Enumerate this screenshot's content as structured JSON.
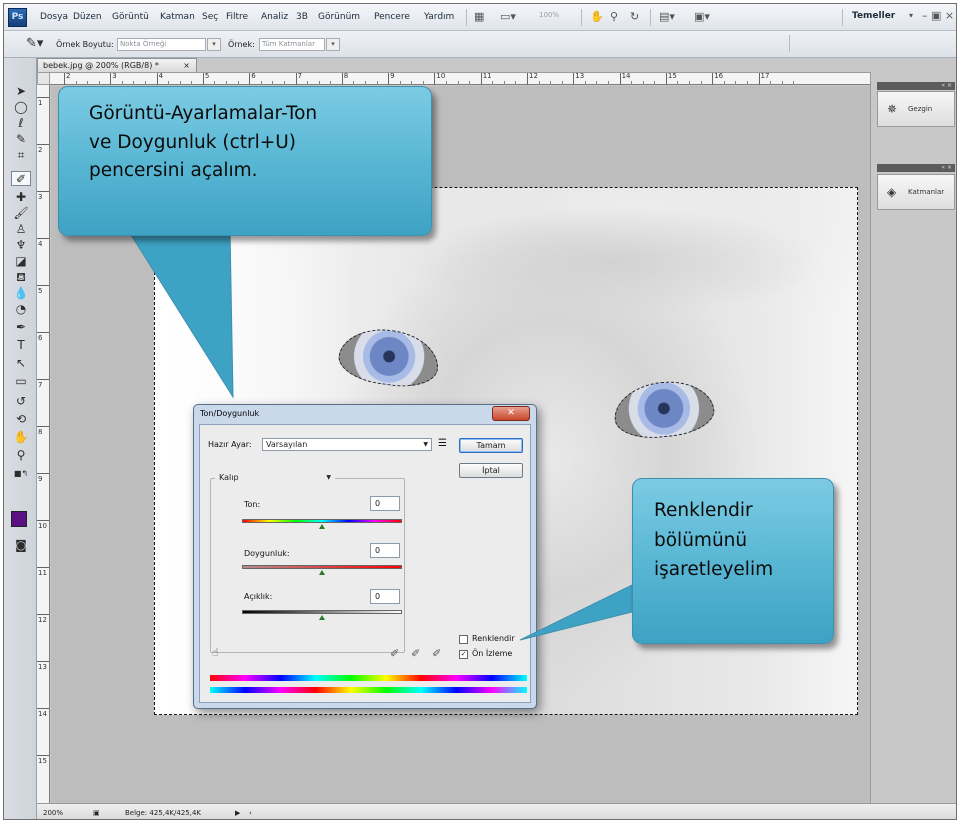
{
  "menubar": {
    "logo": "Ps",
    "items": [
      "Dosya",
      "Düzen",
      "Görüntü",
      "Katman",
      "Seç",
      "Filtre",
      "Analiz",
      "3B",
      "Görünüm",
      "Pencere",
      "Yardım"
    ],
    "zoom": "100%",
    "workspace": "Temeller",
    "window_controls": "– ▣ ×"
  },
  "optionsbar": {
    "sample_size_label": "Örnek Boyutu:",
    "sample_size_value": "Nokta Örneği",
    "sample_label": "Örnek:",
    "sample_value": "Tüm Katmanlar"
  },
  "document": {
    "tab_title": "bebek.jpg @ 200% (RGB/8) *",
    "ruler_h": [
      "2",
      "3",
      "4",
      "5",
      "6",
      "7",
      "8",
      "9",
      "10",
      "11",
      "12",
      "13",
      "14",
      "15",
      "16",
      "17"
    ],
    "ruler_v": [
      "1",
      "2",
      "3",
      "4",
      "5",
      "6",
      "7",
      "8",
      "9",
      "10",
      "11",
      "12",
      "13",
      "14",
      "15"
    ]
  },
  "panels": {
    "navigator_label": "Gezgin",
    "layers_label": "Katmanlar"
  },
  "status": {
    "zoom": "200%",
    "doc_info": "Belge: 425,4K/425,4K"
  },
  "dialog": {
    "title": "Ton/Doygunluk",
    "preset_label": "Hazır Ayar:",
    "preset_value": "Varsayılan",
    "ok_label": "Tamam",
    "cancel_label": "İptal",
    "channel_value": "Kalıp",
    "hue_label": "Ton:",
    "hue_value": "0",
    "saturation_label": "Doygunluk:",
    "saturation_value": "0",
    "lightness_label": "Açıklık:",
    "lightness_value": "0",
    "colorize_label": "Renklendir",
    "colorize_checked": false,
    "preview_label": "Ön İzleme",
    "preview_checked": true
  },
  "callouts": {
    "top_lines": [
      "Görüntü-Ayarlamalar-Ton",
      "ve Doygunluk (ctrl+U)",
      "pencersini açalım."
    ],
    "right_lines": [
      "Renklendir",
      "bölümünü",
      "işaretleyelim"
    ],
    "fill_color": "#5ab8d5"
  }
}
